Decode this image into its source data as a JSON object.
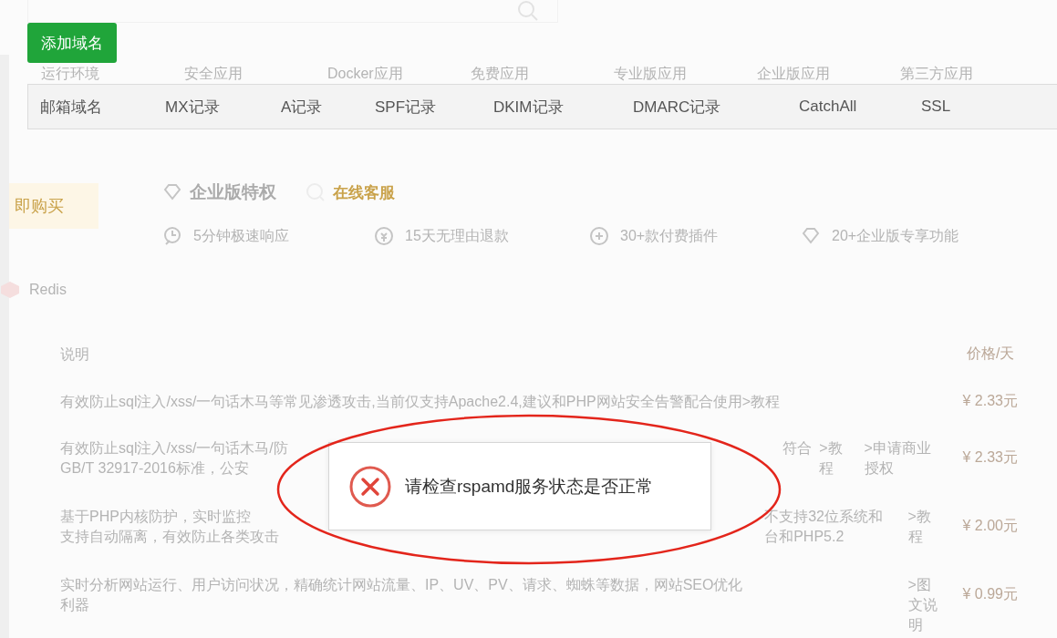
{
  "add_button": "添加域名",
  "app_tabs": [
    "运行环境",
    "安全应用",
    "Docker应用",
    "免费应用",
    "专业版应用",
    "企业版应用",
    "第三方应用"
  ],
  "domain_table": {
    "columns": [
      "邮箱域名",
      "MX记录",
      "A记录",
      "SPF记录",
      "DKIM记录",
      "DMARC记录",
      "CatchAll",
      "SSL"
    ]
  },
  "enterprise": {
    "buy_button": "即购买",
    "title": "企业版特权",
    "service": "在线客服",
    "features": [
      {
        "kind": "clock",
        "label": "5分钟极速响应"
      },
      {
        "kind": "refund",
        "label": "15天无理由退款"
      },
      {
        "kind": "plugin",
        "label": "30+款付费插件"
      },
      {
        "kind": "diamond",
        "label": "20+企业版专享功能"
      }
    ]
  },
  "plugin": {
    "name": "Redis"
  },
  "plugin_table": {
    "columns": [
      "说明",
      "价格/天"
    ],
    "rows": [
      {
        "description": [
          "有效防止sql注入/xss/一句话木马等常见渗透攻击,当前仅支持Apache2.4,建议和PHP网站安全告警配合使用>教程"
        ],
        "fragment": [],
        "links": [],
        "price": "¥ 2.33元"
      },
      {
        "description": [
          "有效防止sql注入/xss/一句话木马/防",
          "GB/T 32917-2016标准，公安"
        ],
        "fragment": [
          "符合"
        ],
        "links": [
          ">教程",
          ">申请商业授权"
        ],
        "price": "¥ 2.33元"
      },
      {
        "description": [
          "基于PHP内核防护，实时监控",
          "支持自动隔离，有效防止各类攻击"
        ],
        "fragment": [
          "不支持32位系统和",
          "台和PHP5.2"
        ],
        "links": [
          ">教程"
        ],
        "price": "¥ 2.00元"
      },
      {
        "description": [
          "实时分析网站运行、用户访问状况，精确统计网站流量、IP、UV、PV、请求、蜘蛛等数据，网站SEO优化",
          "利器"
        ],
        "fragment": [],
        "links": [
          ">图文说明"
        ],
        "price": "¥ 0.99元"
      }
    ]
  },
  "alert": {
    "kind": "error",
    "message": "请检查rspamd服务状态是否正常"
  }
}
